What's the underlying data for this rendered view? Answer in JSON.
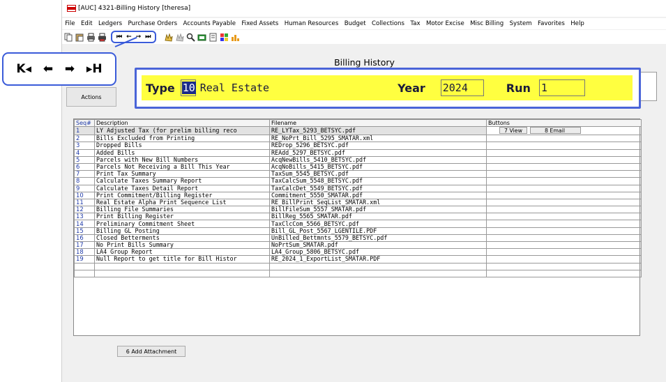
{
  "window": {
    "title": "[AUC] 4321-Billing History [theresa]"
  },
  "menu": [
    "File",
    "Edit",
    "Ledgers",
    "Purchase Orders",
    "Accounts Payable",
    "Fixed Assets",
    "Human Resources",
    "Budget",
    "Collections",
    "Tax",
    "Motor Excise",
    "Misc Billing",
    "System",
    "Favorites",
    "Help"
  ],
  "toolbar": {
    "nav": {
      "first": "⏮",
      "prev": "←",
      "next": "→",
      "last": "⏭"
    }
  },
  "overlay_nav": {
    "first": "K◂",
    "prev": "⬅",
    "next": "➡",
    "last": "▸H"
  },
  "page_title": "Billing History",
  "header": {
    "type_label": "Type",
    "type_code": "10",
    "type_desc": "Real Estate",
    "year_label": "Year",
    "year_value": "2024",
    "run_label": "Run",
    "run_value": "1"
  },
  "actions_label": "Actions",
  "grid": {
    "columns": {
      "seq": "Seq#",
      "description": "Description",
      "filename": "Filename",
      "buttons": "Buttons"
    },
    "rows": [
      {
        "seq": "1",
        "desc": "LY Adjusted Tax (for prelim billing reco",
        "file": "RE_LYTax_5293_BETSYC.pdf"
      },
      {
        "seq": "2",
        "desc": "Bills Excluded from Printing",
        "file": "RE_NoPrt_Bill_5295_SMATAR.xml"
      },
      {
        "seq": "3",
        "desc": "Dropped Bills",
        "file": "REDrop_5296_BETSYC.pdf"
      },
      {
        "seq": "4",
        "desc": "Added Bills",
        "file": "REAdd_5297_BETSYC.pdf"
      },
      {
        "seq": "5",
        "desc": "Parcels with New Bill Numbers",
        "file": "AcqNewBills_5410_BETSYC.pdf"
      },
      {
        "seq": "6",
        "desc": "Parcels Not Receiving a Bill This Year",
        "file": "AcqNoBills_5415_BETSYC.pdf"
      },
      {
        "seq": "7",
        "desc": "Print Tax Summary",
        "file": "TaxSum_5545_BETSYC.pdf"
      },
      {
        "seq": "8",
        "desc": "Calculate Taxes Summary Report",
        "file": "TaxCalcSum_5548_BETSYC.pdf"
      },
      {
        "seq": "9",
        "desc": "Calculate Taxes Detail Report",
        "file": "TaxCalcDet_5549_BETSYC.pdf"
      },
      {
        "seq": "10",
        "desc": "Print Commitment/Billing Register",
        "file": "Commitment_5550_SMATAR.pdf"
      },
      {
        "seq": "11",
        "desc": "Real Estate Alpha Print Sequence List",
        "file": "RE_BillPrint_SeqList_SMATAR.xml"
      },
      {
        "seq": "12",
        "desc": "Billing File Summaries",
        "file": "BillFileSum_5557_SMATAR.pdf"
      },
      {
        "seq": "13",
        "desc": "Print Billing Register",
        "file": "BillReg_5565_SMATAR.pdf"
      },
      {
        "seq": "14",
        "desc": "Preliminary Commitment Sheet",
        "file": "TaxClcCom_5566_BETSYC.pdf"
      },
      {
        "seq": "15",
        "desc": "Billing GL Posting",
        "file": "Bill_GL_Post_5567_LGENTILE.PDF"
      },
      {
        "seq": "16",
        "desc": "Closed Betterments",
        "file": "UnBilled_Bettmnts_5579_BETSYC.pdf"
      },
      {
        "seq": "17",
        "desc": "No Print Bills Summary",
        "file": "NoPrtSum_SMATAR.pdf"
      },
      {
        "seq": "18",
        "desc": "LA4 Group Report",
        "file": "LA4_Group_5806_BETSYC.pdf"
      },
      {
        "seq": "19",
        "desc": "Null Report to get title for Bill Histor",
        "file": "RE_2024_1_ExportList_SMATAR.PDF"
      }
    ],
    "row_buttons": {
      "view": "7 View",
      "email": "8 Email"
    }
  },
  "attach_label": "6 Add Attachment",
  "colors": {
    "highlight": "#ffff40",
    "accent_blue": "#3a5bd9",
    "title_red": "#cc0000"
  }
}
